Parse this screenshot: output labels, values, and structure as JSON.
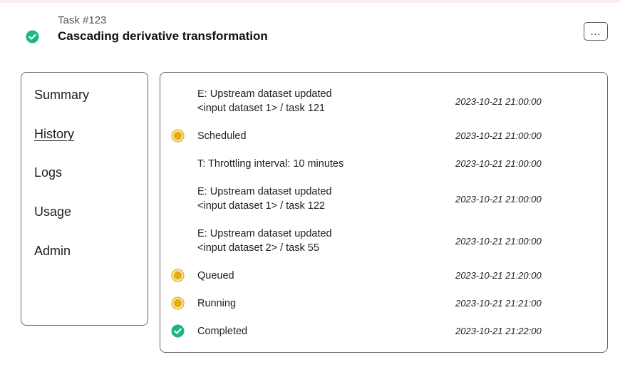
{
  "header": {
    "task_number": "Task #123",
    "task_title": "Cascading derivative transformation",
    "more_label": "..."
  },
  "sidebar": {
    "items": [
      {
        "label": "Summary"
      },
      {
        "label": "History"
      },
      {
        "label": "Logs"
      },
      {
        "label": "Usage"
      },
      {
        "label": "Admin"
      }
    ],
    "active": "History"
  },
  "history": {
    "events": [
      {
        "icon": "none",
        "lines": [
          "E: Upstream dataset updated",
          "<input dataset 1> / task 121"
        ],
        "time": "2023-10-21 21:00:00"
      },
      {
        "icon": "pending-dot-icon",
        "lines": [
          "Scheduled"
        ],
        "time": "2023-10-21 21:00:00"
      },
      {
        "icon": "none",
        "lines": [
          "T: Throttling interval: 10 minutes"
        ],
        "time": "2023-10-21 21:00:00"
      },
      {
        "icon": "none",
        "lines": [
          "E: Upstream dataset updated",
          "<input dataset 1> / task 122"
        ],
        "time": "2023-10-21 21:00:00"
      },
      {
        "icon": "none",
        "lines": [
          "E: Upstream dataset updated",
          "<input dataset 2> / task 55"
        ],
        "time": "2023-10-21 21:00:00"
      },
      {
        "icon": "pending-dot-icon",
        "lines": [
          "Queued"
        ],
        "time": "2023-10-21 21:20:00"
      },
      {
        "icon": "pending-dot-icon",
        "lines": [
          "Running"
        ],
        "time": "2023-10-21 21:21:00"
      },
      {
        "icon": "check-circle-icon",
        "lines": [
          "Completed"
        ],
        "time": "2023-10-21 21:22:00"
      }
    ]
  },
  "colors": {
    "success": "#1fb38a",
    "pending_fill": "#e5ad12",
    "pending_ring": "#f7e4b2",
    "border": "#666666",
    "top_strip": "#fbeef1"
  }
}
